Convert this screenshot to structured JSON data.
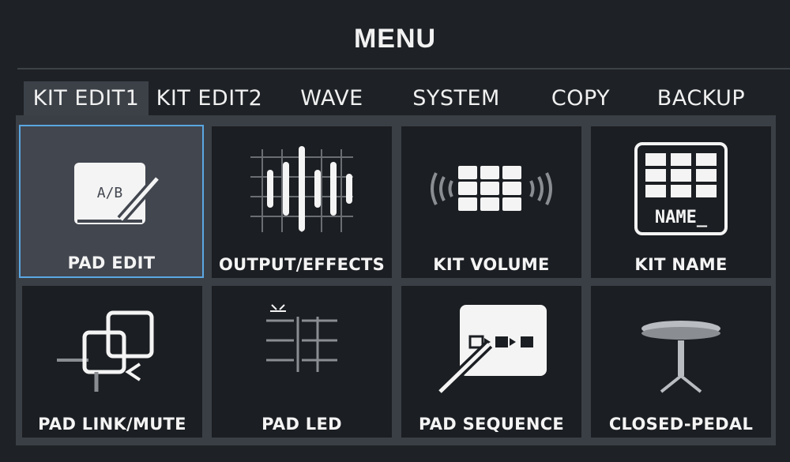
{
  "header": {
    "title": "MENU"
  },
  "tabs": [
    {
      "label": "KIT EDIT1",
      "active": true
    },
    {
      "label": "KIT EDIT2",
      "active": false
    },
    {
      "label": "WAVE",
      "active": false
    },
    {
      "label": "SYSTEM",
      "active": false
    },
    {
      "label": "COPY",
      "active": false
    },
    {
      "label": "BACKUP",
      "active": false
    }
  ],
  "tiles": [
    {
      "label": "PAD EDIT",
      "icon": "pad-edit-icon",
      "icon_text": "A/B",
      "selected": true
    },
    {
      "label": "OUTPUT/EFFECTS",
      "icon": "output-effects-icon",
      "selected": false
    },
    {
      "label": "KIT VOLUME",
      "icon": "kit-volume-icon",
      "selected": false
    },
    {
      "label": "KIT NAME",
      "icon": "kit-name-icon",
      "icon_text": "NAME_",
      "selected": false
    },
    {
      "label": "PAD LINK/MUTE",
      "icon": "pad-link-mute-icon",
      "selected": false
    },
    {
      "label": "PAD LED",
      "icon": "pad-led-icon",
      "selected": false
    },
    {
      "label": "PAD SEQUENCE",
      "icon": "pad-sequence-icon",
      "selected": false
    },
    {
      "label": "CLOSED-PEDAL",
      "icon": "closed-pedal-icon",
      "selected": false
    }
  ],
  "colors": {
    "background": "#1e2226",
    "tile": "#1b1e22",
    "selected_border": "#5aa7e2",
    "tab_active": "#3c4148"
  }
}
